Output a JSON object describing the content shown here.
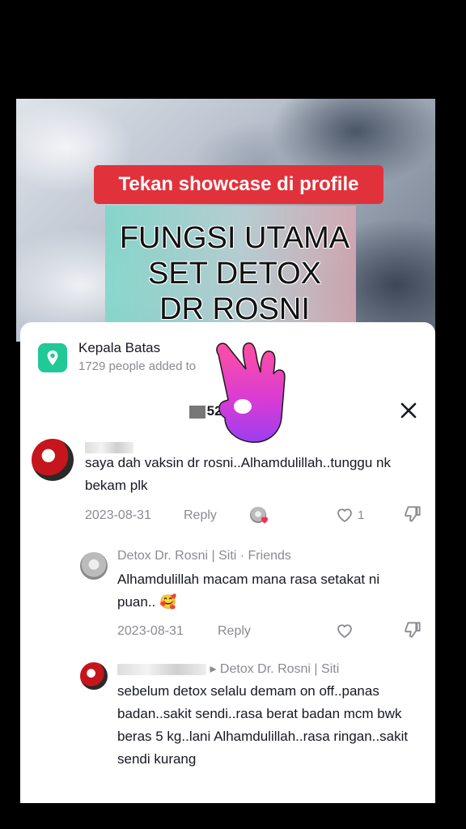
{
  "video": {
    "tag": "Tekan showcase di profile",
    "title_lines": [
      "FUNGSI UTAMA",
      "SET DETOX",
      "DR ROSNI"
    ]
  },
  "location": {
    "name": "Kepala Batas",
    "subtitle": "1729 people added to"
  },
  "comments_header": {
    "count": "52 comm"
  },
  "comments": [
    {
      "text": "saya dah vaksin dr rosni..Alhamdulillah..tunggu nk bekam plk",
      "date": "2023-08-31",
      "reply_label": "Reply",
      "likes": "1"
    },
    {
      "author": "Detox Dr. Rosni | Siti · Friends",
      "text": "Alhamdulillah macam mana rasa setakat ni puan.. 🥰",
      "date": "2023-08-31",
      "reply_label": "Reply"
    },
    {
      "reply_to": "▸ Detox Dr. Rosni | Siti",
      "text": "sebelum detox selalu demam on off..panas badan..sakit sendi..rasa berat badan mcm bwk beras 5 kg..lani Alhamdulillah..rasa ringan..sakit sendi kurang"
    }
  ],
  "colors": {
    "tag_bg": "#e1323c",
    "location_icon": "#20c997",
    "liked_heart": "#fe2c55"
  },
  "icons": [
    "location-pin-icon",
    "close-icon",
    "heart-icon",
    "dislike-icon",
    "ok-hand-emoji"
  ]
}
